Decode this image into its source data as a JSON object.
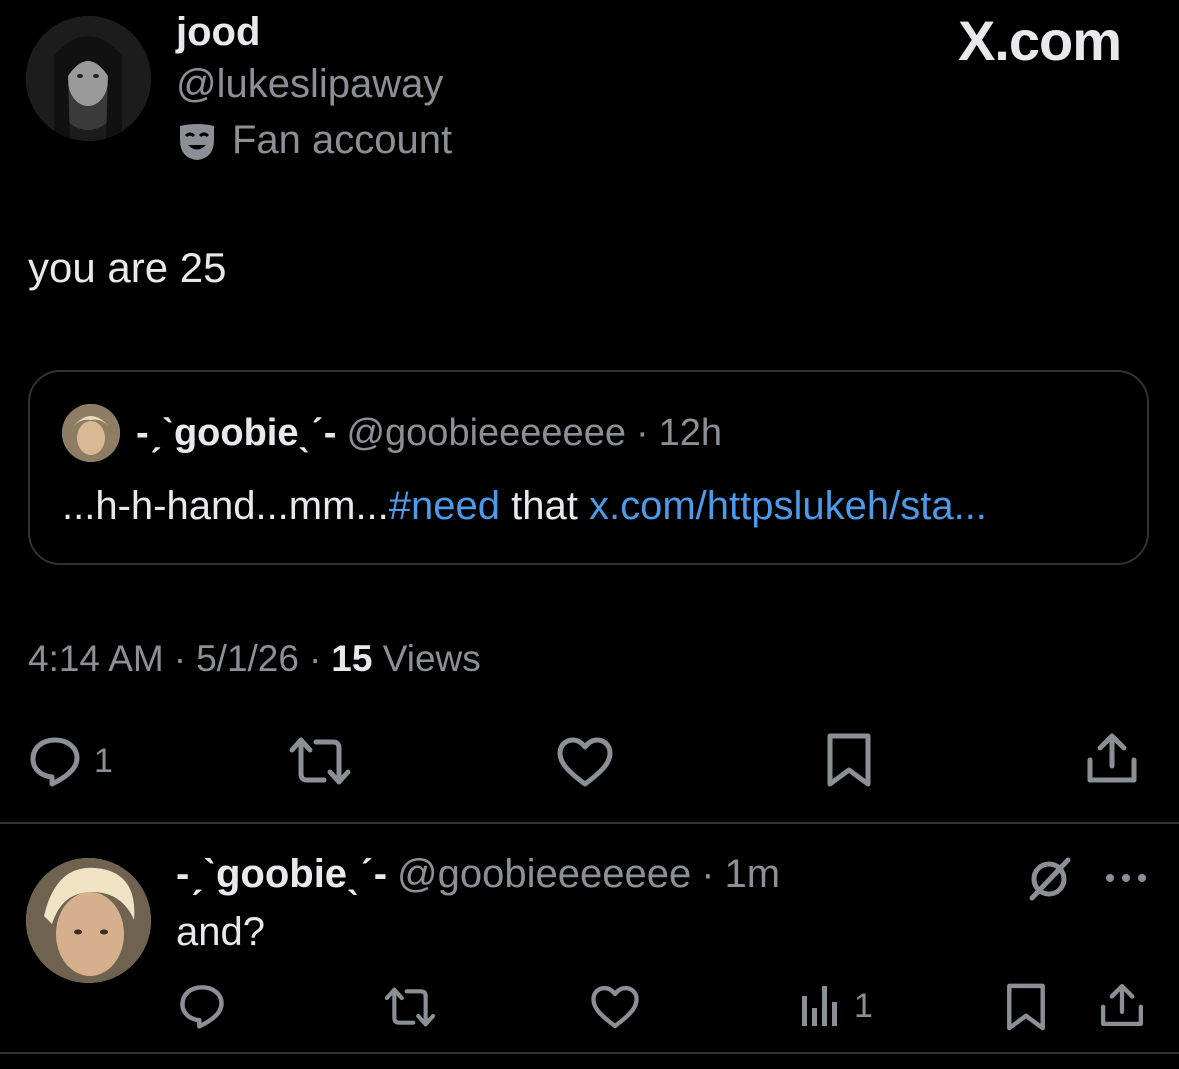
{
  "tweet": {
    "author_name": "jood",
    "author_handle": "@lukeslipaway",
    "badge_label": "Fan account",
    "text": "you are 25",
    "time": "4:14 AM",
    "date": "5/1/26",
    "views_count": "15",
    "views_label": "Views",
    "reply_count": "1"
  },
  "brand": "X.com",
  "quote": {
    "name": "-ˏˋgoobieˎˊ-",
    "handle": "@goobieeeeeee",
    "time": "12h",
    "text_start": "...h-h-hand...mm...",
    "hashtag": "#need",
    "text_mid": " that ",
    "link": "x.com/httpslukeh/sta..."
  },
  "reply": {
    "name": "-ˏˋgoobieˎˊ-",
    "handle": "@goobieeeeeee",
    "time": "1m",
    "text": "and?",
    "views_count": "1"
  },
  "separator": "·",
  "colors": {
    "background": "#000000",
    "text": "#e7e9ea",
    "muted": "#8b9096",
    "link": "#4c9ae8",
    "border": "#2f3336"
  },
  "icons": [
    "comedy-mask-icon",
    "reply-icon",
    "retweet-icon",
    "like-icon",
    "bookmark-icon",
    "share-icon",
    "views-icon",
    "grok-icon",
    "more-icon"
  ]
}
